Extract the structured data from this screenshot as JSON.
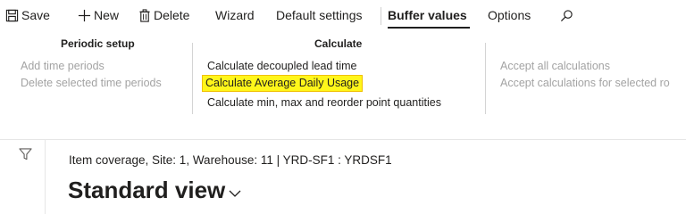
{
  "toolbar": {
    "save_label": "Save",
    "new_label": "New",
    "delete_label": "Delete",
    "wizard_label": "Wizard",
    "default_settings_label": "Default settings",
    "buffer_values_label": "Buffer values",
    "options_label": "Options",
    "search_icon": "search-icon",
    "active_tab": "Buffer values"
  },
  "groups": {
    "periodic": {
      "title": "Periodic setup",
      "items": [
        "Add time periods",
        "Delete selected time periods"
      ]
    },
    "calculate": {
      "title": "Calculate",
      "items": [
        "Calculate decoupled lead time",
        "Calculate Average Daily Usage",
        "Calculate min, max and reorder point quantities"
      ],
      "highlighted_item": "Calculate Average Daily Usage"
    },
    "accept": {
      "items": [
        "Accept all calculations",
        "Accept calculations for selected ro"
      ]
    }
  },
  "content": {
    "context_line": "Item coverage, Site: 1, Warehouse: 11  |  YRD-SF1 : YRDSF1",
    "view_title": "Standard view"
  },
  "colors": {
    "highlight": "#fff61a",
    "highlight_border": "#f0c000",
    "disabled_text": "#a3a3a3",
    "text": "#201f1e"
  }
}
